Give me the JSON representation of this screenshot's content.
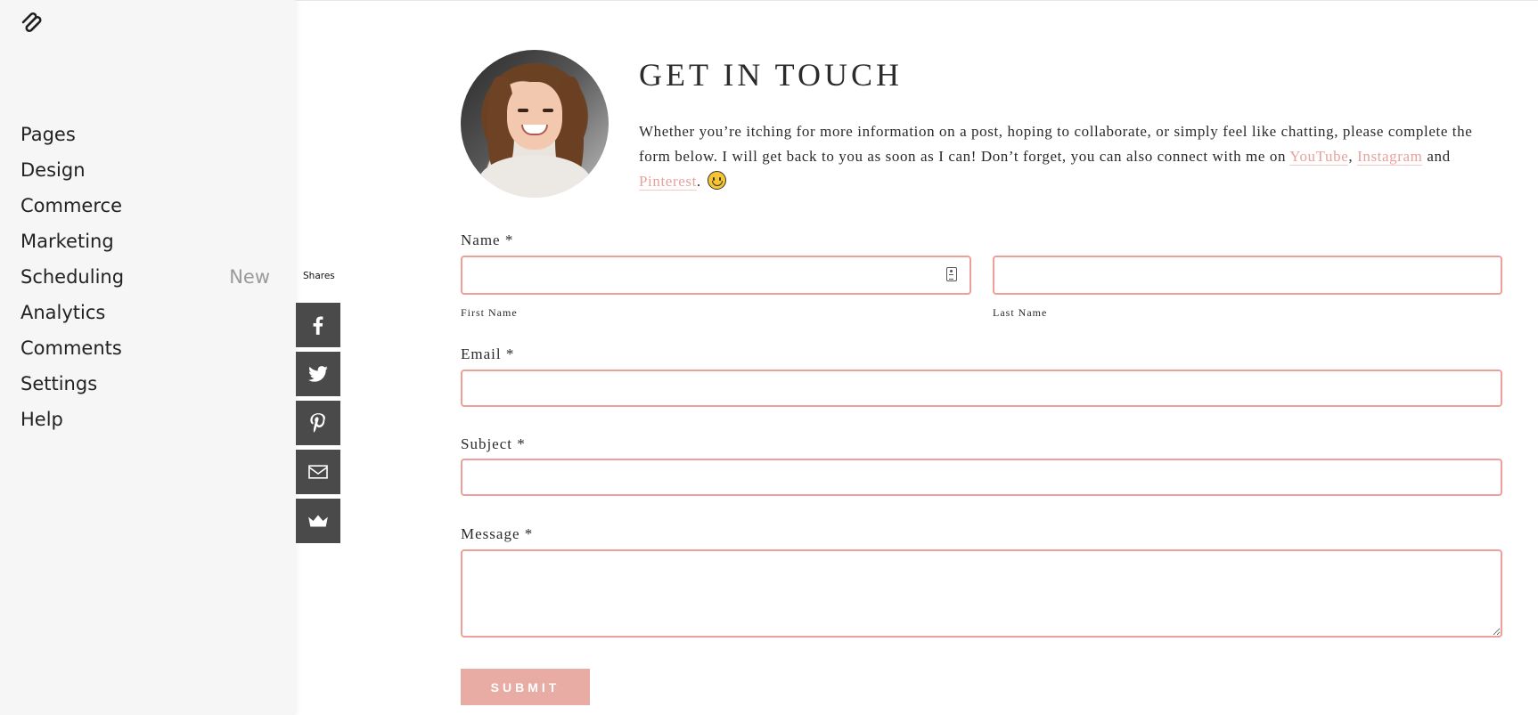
{
  "sidebar": {
    "logo_icon": "squarespace-logo-icon",
    "items": [
      {
        "label": "Pages",
        "badge": ""
      },
      {
        "label": "Design",
        "badge": ""
      },
      {
        "label": "Commerce",
        "badge": ""
      },
      {
        "label": "Marketing",
        "badge": ""
      },
      {
        "label": "Scheduling",
        "badge": "New"
      },
      {
        "label": "Analytics",
        "badge": ""
      },
      {
        "label": "Comments",
        "badge": ""
      },
      {
        "label": "Settings",
        "badge": ""
      },
      {
        "label": "Help",
        "badge": ""
      }
    ]
  },
  "share_bar": {
    "label": "Shares",
    "buttons": [
      {
        "icon": "facebook-icon"
      },
      {
        "icon": "twitter-icon"
      },
      {
        "icon": "pinterest-icon"
      },
      {
        "icon": "email-icon"
      },
      {
        "icon": "crown-icon"
      }
    ],
    "background_color": "#4a4a4a"
  },
  "header": {
    "title": "GET IN TOUCH",
    "intro_text": "Whether you’re itching for more information on a post, hoping to collaborate, or simply feel like chatting, please complete the form below. I will get back to you as soon as I can! Don’t forget, you can also connect with me on ",
    "links": {
      "youtube": "YouTube",
      "instagram": "Instagram",
      "pinterest": "Pinterest"
    },
    "separator_comma": ", ",
    "and_text": " and ",
    "end_text": ". ",
    "emoji": "slightly-smiling-face-icon"
  },
  "form": {
    "name_label": "Name *",
    "first_name_sublabel": "First Name",
    "last_name_sublabel": "Last Name",
    "first_name_value": "",
    "last_name_value": "",
    "email_label": "Email *",
    "email_value": "",
    "subject_label": "Subject *",
    "subject_value": "",
    "message_label": "Message *",
    "message_value": "",
    "submit_label": "SUBMIT"
  },
  "colors": {
    "accent": "#e8a29c",
    "field_border": "#ee9f97",
    "submit_bg": "#e8aca5",
    "sidebar_bg": "#f6f6f6"
  }
}
